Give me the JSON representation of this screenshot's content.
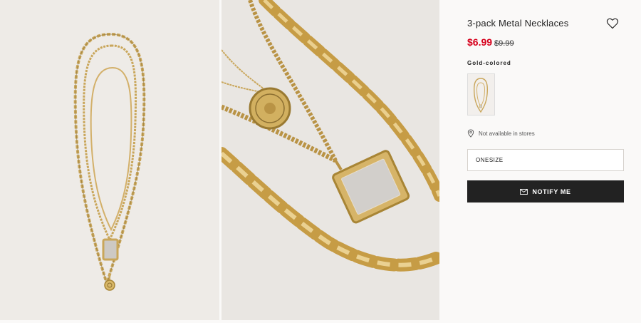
{
  "product": {
    "title": "3-pack Metal Necklaces",
    "price_sale": "$6.99",
    "price_old": "$9.99",
    "color_label": "Gold-colored",
    "availability": "Not available in stores",
    "size_value": "ONESIZE",
    "notify_label": "NOTIFY ME"
  },
  "icons": {
    "wishlist": "heart-icon",
    "location": "location-pin-icon",
    "notify": "envelope-icon"
  },
  "colors": {
    "sale_price": "#d6001c",
    "button_bg": "#222222",
    "gold": "#c9a65a"
  }
}
